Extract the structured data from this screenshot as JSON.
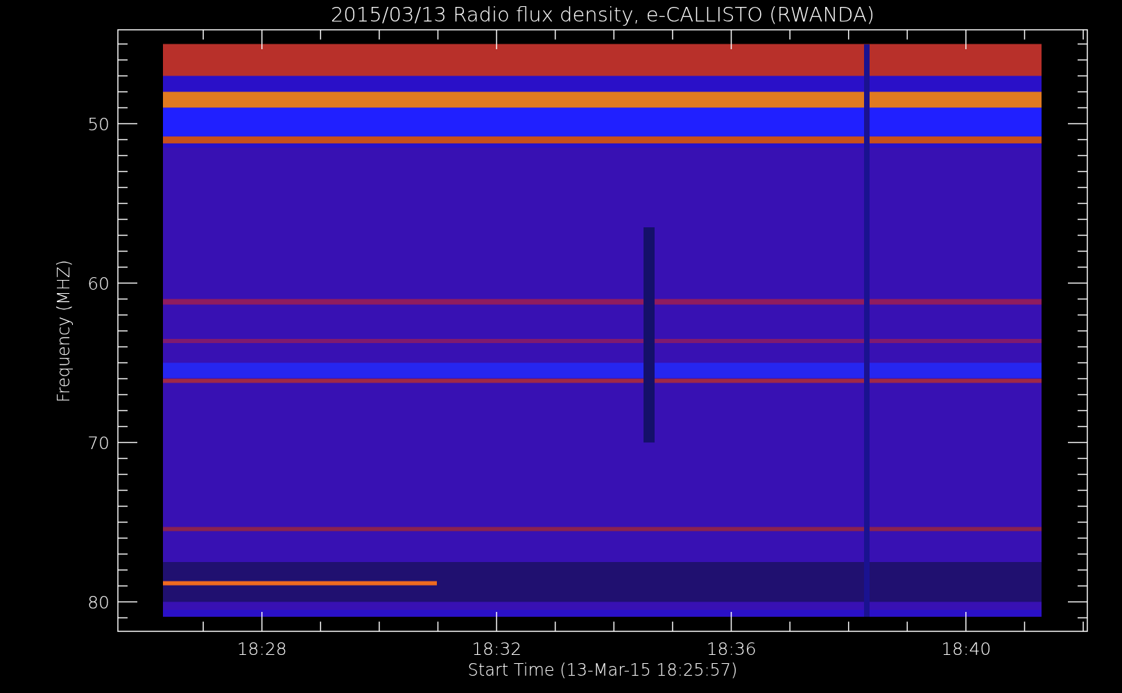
{
  "title": "2015/03/13  Radio flux density, e-CALLISTO (RWANDA)",
  "plot": {
    "ylabel": "Frequency (MHZ)",
    "xlabel": "Start Time (13-Mar-15 18:25:57)",
    "yticks": [
      "50",
      "60",
      "70",
      "80"
    ],
    "xticks": [
      "18:28",
      "18:32",
      "18:36",
      "18:40"
    ]
  }
}
